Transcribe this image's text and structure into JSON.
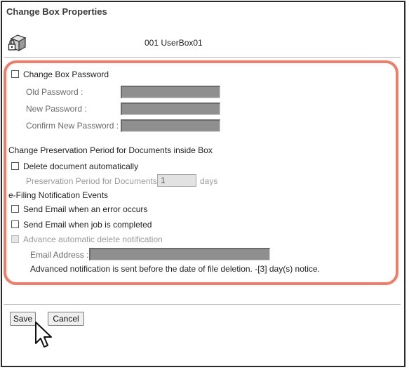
{
  "header": {
    "title": "Change Box Properties",
    "box_name": "001 UserBox01"
  },
  "password": {
    "checkbox_label": "Change Box Password",
    "old_label": "Old Password :",
    "new_label": "New Password :",
    "confirm_label": "Confirm New Password :"
  },
  "preservation": {
    "section_label": "Change Preservation Period for Documents inside Box",
    "delete_label": "Delete document automatically",
    "period_label": "Preservation Period for Documents :",
    "period_value": "1",
    "period_unit": "days"
  },
  "notification": {
    "section_label": "e-Filing Notification Events",
    "error_label": "Send Email when an error occurs",
    "completed_label": "Send Email when job is completed",
    "advance_label": "Advance automatic delete notification",
    "email_label": "Email Address :",
    "advance_note": "Advanced notification is sent before the date of file deletion. -[3] day(s) notice."
  },
  "buttons": {
    "save": "Save",
    "cancel": "Cancel"
  },
  "colors": {
    "highlight": "#ef7d6a",
    "field_fill": "#8f8f8f"
  },
  "icons": {
    "box": "locked-box-icon",
    "cursor": "mouse-pointer-icon"
  }
}
